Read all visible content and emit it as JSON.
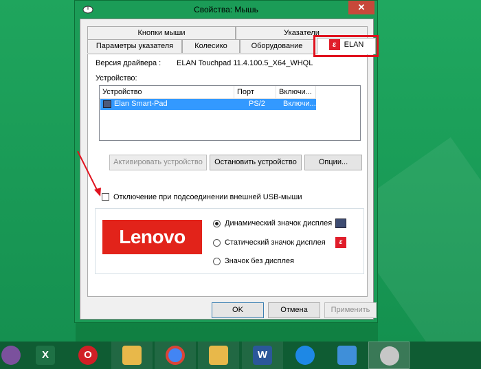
{
  "window": {
    "title": "Свойства: Мышь",
    "close_symbol": "✕"
  },
  "tabs": {
    "row1": [
      "Кнопки мыши",
      "Указатели"
    ],
    "row2": [
      "Параметры указателя",
      "Колесико",
      "Оборудование",
      "ELAN"
    ],
    "active": "ELAN"
  },
  "driver": {
    "label": "Версия драйвера :",
    "value": "ELAN Touchpad 11.4.100.5_X64_WHQL"
  },
  "devices": {
    "label": "Устройство:",
    "columns": [
      "Устройство",
      "Порт",
      "Включи..."
    ],
    "rows": [
      {
        "name": "Elan Smart-Pad",
        "port": "PS/2",
        "enabled": "Включи..."
      }
    ]
  },
  "buttons": {
    "activate": "Активировать устройство",
    "stop": "Остановить устройство",
    "options": "Опции..."
  },
  "usb_disable": {
    "label": "Отключение при подсоединении внешней USB-мыши",
    "checked": false
  },
  "display": {
    "brand": "Lenovo",
    "options": [
      {
        "label": "Динамический значок дисплея",
        "checked": true,
        "icon": "screen-icon"
      },
      {
        "label": "Статический значок дисплея",
        "checked": false,
        "icon": "elan-icon"
      },
      {
        "label": "Значок без дисплея",
        "checked": false,
        "icon": ""
      }
    ]
  },
  "dialog_buttons": {
    "ok": "OK",
    "cancel": "Отмена",
    "apply": "Применить"
  },
  "taskbar": {
    "items": [
      {
        "name": "viber-icon",
        "color": "#7b519d"
      },
      {
        "name": "excel-icon",
        "color": "#1e7145"
      },
      {
        "name": "opera-icon",
        "color": "#d11f26"
      },
      {
        "name": "file-explorer-icon",
        "color": "#e8b84a"
      },
      {
        "name": "chrome-icon",
        "color": "#4285f4"
      },
      {
        "name": "file-explorer-icon",
        "color": "#e8b84a"
      },
      {
        "name": "word-icon",
        "color": "#2b579a"
      },
      {
        "name": "bird-icon",
        "color": "#1e88e5"
      },
      {
        "name": "control-panel-icon",
        "color": "#3f8fd9"
      },
      {
        "name": "mouse-icon",
        "color": "#c7c7c7"
      }
    ]
  },
  "colors": {
    "accent_red": "#e0121e",
    "selection": "#3399ff",
    "lenovo_red": "#e2231a"
  }
}
